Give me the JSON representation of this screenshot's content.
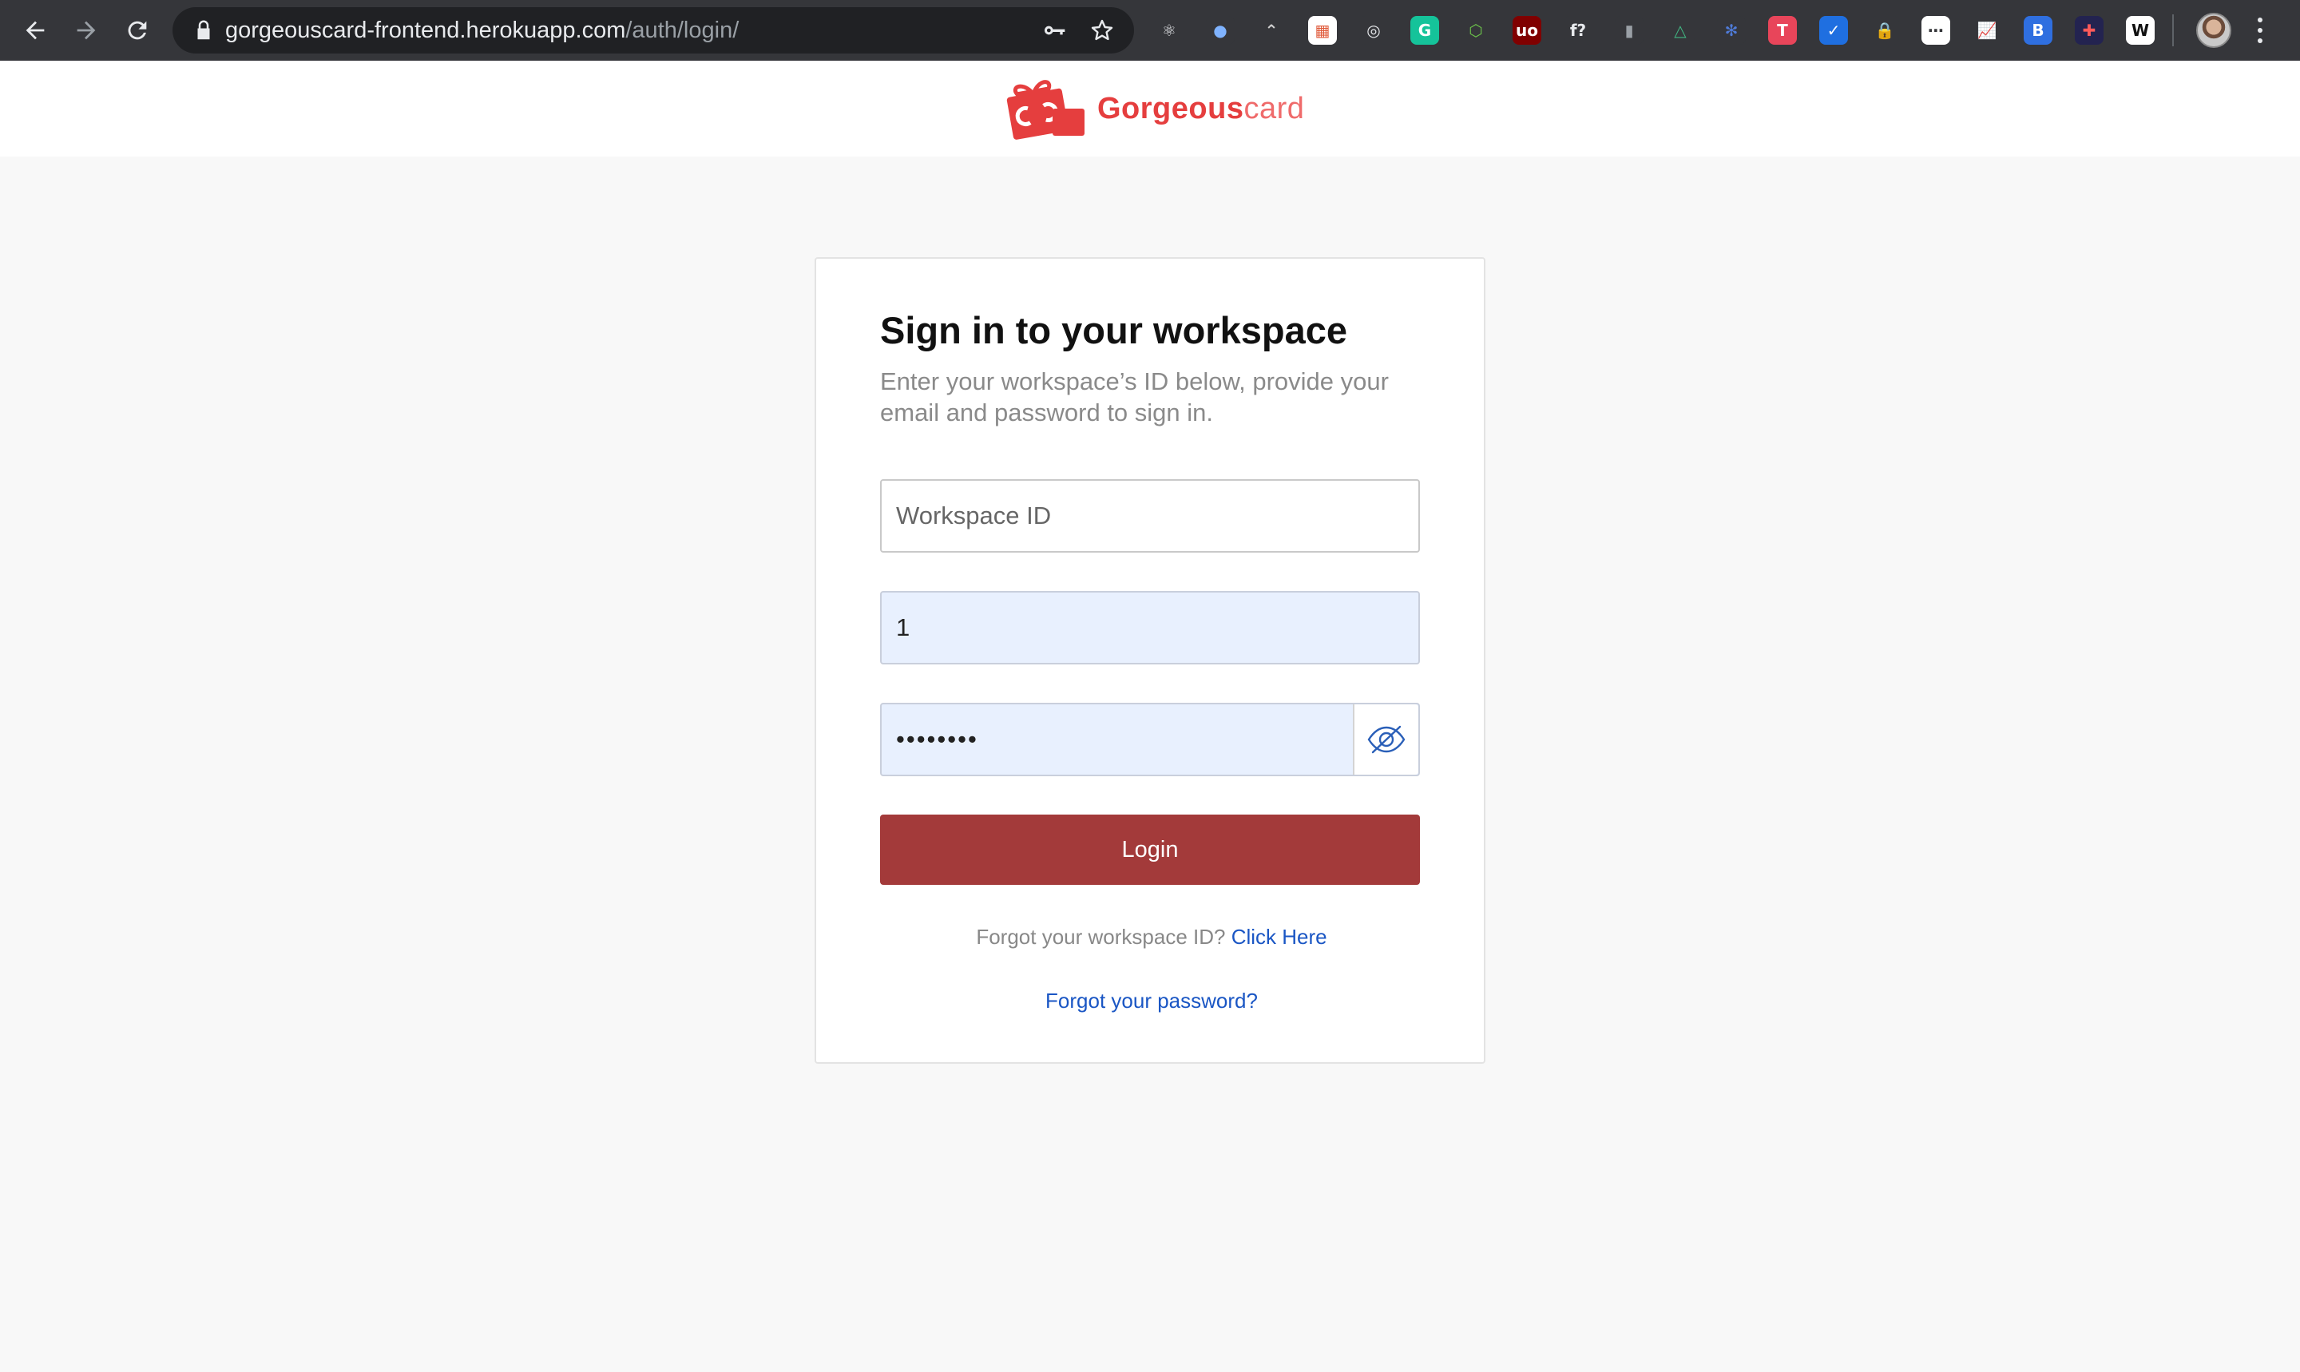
{
  "browser": {
    "url_host": "gorgeouscard-frontend.herokuapp.com",
    "url_path": "/auth/login/",
    "extensions": [
      {
        "name": "react-devtools-icon",
        "glyph": "⚛",
        "bg": "#35363a",
        "fg": "#e8eaed"
      },
      {
        "name": "extension-circle-icon",
        "glyph": "●",
        "bg": "#35363a",
        "fg": "#7fb3ff"
      },
      {
        "name": "extension-wave-icon",
        "glyph": "⌃",
        "bg": "#35363a",
        "fg": "#cfcfcf"
      },
      {
        "name": "extension-badge-icon",
        "glyph": "▦",
        "bg": "#ffffff",
        "fg": "#e05a3a"
      },
      {
        "name": "extension-target-icon",
        "glyph": "◎",
        "bg": "#35363a",
        "fg": "#e8eaed"
      },
      {
        "name": "grammarly-icon",
        "glyph": "G",
        "bg": "#15c39a",
        "fg": "#ffffff"
      },
      {
        "name": "nodejs-icon",
        "glyph": "⬡",
        "bg": "#35363a",
        "fg": "#6cc24a"
      },
      {
        "name": "ublock-icon",
        "glyph": "uo",
        "bg": "#800000",
        "fg": "#ffffff"
      },
      {
        "name": "whatfont-icon",
        "glyph": "f?",
        "bg": "#35363a",
        "fg": "#e8eaed"
      },
      {
        "name": "extension-bars-icon",
        "glyph": "▮",
        "bg": "#35363a",
        "fg": "#9aa0a6"
      },
      {
        "name": "vue-devtools-icon",
        "glyph": "△",
        "bg": "#35363a",
        "fg": "#41b883"
      },
      {
        "name": "extension-gear-icon",
        "glyph": "✻",
        "bg": "#35363a",
        "fg": "#4f7bd8"
      },
      {
        "name": "extension-pink-icon",
        "glyph": "T",
        "bg": "#e8455a",
        "fg": "#ffffff"
      },
      {
        "name": "extension-check-icon",
        "glyph": "✓",
        "bg": "#1f6fe0",
        "fg": "#ffffff"
      },
      {
        "name": "extension-lock-icon",
        "glyph": "🔒",
        "bg": "#35363a",
        "fg": "#e8b80e"
      },
      {
        "name": "extension-dots-icon",
        "glyph": "⋯",
        "bg": "#ffffff",
        "fg": "#35363a"
      },
      {
        "name": "extension-chart-icon",
        "glyph": "📈",
        "bg": "#35363a",
        "fg": "#e0a030"
      },
      {
        "name": "extension-blue-icon",
        "glyph": "B",
        "bg": "#2f6fe0",
        "fg": "#ffffff"
      },
      {
        "name": "extension-color-icon",
        "glyph": "✚",
        "bg": "#232350",
        "fg": "#ff5a5a"
      },
      {
        "name": "extension-w-icon",
        "glyph": "W",
        "bg": "#ffffff",
        "fg": "#111111"
      }
    ]
  },
  "header": {
    "logo_strong": "Gorgeous",
    "logo_light": "card"
  },
  "login": {
    "title": "Sign in to your workspace",
    "subtitle": "Enter your workspace’s ID below, provide your email and password to sign in.",
    "workspace_placeholder": "Workspace ID",
    "workspace_value": "",
    "email_value": "1",
    "password_value": "••••••••",
    "login_label": "Login",
    "forgot_workspace_text": "Forgot your workspace ID?",
    "forgot_workspace_link": "Click Here",
    "forgot_password_link": "Forgot your password?"
  },
  "colors": {
    "brand": "#e53e3e",
    "button": "#a33a3a",
    "link": "#1a56c4",
    "autofill": "#e8f0fe"
  }
}
